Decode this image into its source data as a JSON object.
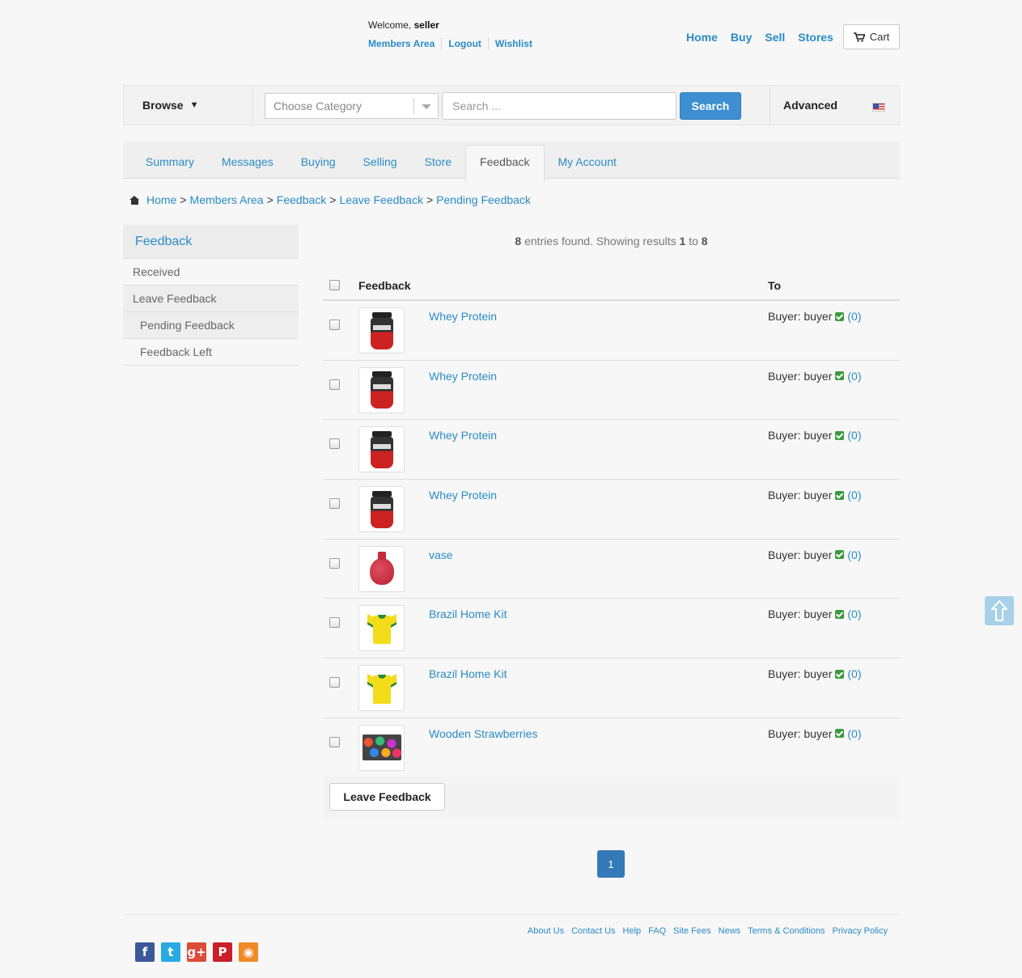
{
  "header": {
    "welcome_prefix": "Welcome,",
    "username": "seller",
    "member_links": [
      "Members Area",
      "Logout",
      "Wishlist"
    ],
    "nav": [
      "Home",
      "Buy",
      "Sell",
      "Stores"
    ],
    "cart_label": "Cart"
  },
  "search_bar": {
    "browse_label": "Browse",
    "category_placeholder": "Choose Category",
    "search_placeholder": "Search ...",
    "search_button": "Search",
    "advanced_label": "Advanced"
  },
  "tabs": [
    {
      "label": "Summary",
      "active": false
    },
    {
      "label": "Messages",
      "active": false
    },
    {
      "label": "Buying",
      "active": false
    },
    {
      "label": "Selling",
      "active": false
    },
    {
      "label": "Store",
      "active": false
    },
    {
      "label": "Feedback",
      "active": true
    },
    {
      "label": "My Account",
      "active": false
    }
  ],
  "breadcrumb": {
    "items": [
      "Home",
      "Members Area",
      "Feedback",
      "Leave Feedback",
      "Pending Feedback"
    ],
    "separator": ">"
  },
  "sidebar": {
    "heading": "Feedback",
    "items": [
      "Received",
      "Leave Feedback",
      "Pending Feedback",
      "Feedback Left"
    ]
  },
  "results": {
    "total": "8",
    "text_mid": "entries found. Showing results",
    "from": "1",
    "to_word": "to",
    "to": "8"
  },
  "table": {
    "col_feedback": "Feedback",
    "col_to": "To",
    "rows": [
      {
        "title": "Whey Protein",
        "to": "Buyer: buyer",
        "count": "(0)",
        "image": "whey"
      },
      {
        "title": "Whey Protein",
        "to": "Buyer: buyer",
        "count": "(0)",
        "image": "whey"
      },
      {
        "title": "Whey Protein",
        "to": "Buyer: buyer",
        "count": "(0)",
        "image": "whey"
      },
      {
        "title": "Whey Protein",
        "to": "Buyer: buyer",
        "count": "(0)",
        "image": "whey"
      },
      {
        "title": "vase",
        "to": "Buyer: buyer",
        "count": "(0)",
        "image": "vase"
      },
      {
        "title": "Brazil Home Kit",
        "to": "Buyer: buyer",
        "count": "(0)",
        "image": "shirt"
      },
      {
        "title": "Brazil Home Kit",
        "to": "Buyer: buyer",
        "count": "(0)",
        "image": "shirt"
      },
      {
        "title": "Wooden Strawberries",
        "to": "Buyer: buyer",
        "count": "(0)",
        "image": "strawberries"
      }
    ],
    "leave_feedback_button": "Leave Feedback"
  },
  "pagination": {
    "current": "1"
  },
  "footer": {
    "links": [
      "About Us",
      "Contact Us",
      "Help",
      "FAQ",
      "Site Fees",
      "News",
      "Terms & Conditions",
      "Privacy Policy"
    ],
    "social": [
      {
        "name": "facebook-icon",
        "glyph": "f",
        "color": "#3b5998"
      },
      {
        "name": "twitter-icon",
        "glyph": "t",
        "color": "#29a9e1"
      },
      {
        "name": "google-plus-icon",
        "glyph": "g+",
        "color": "#dd4b39"
      },
      {
        "name": "pinterest-icon",
        "glyph": "P",
        "color": "#cb2027"
      },
      {
        "name": "rss-icon",
        "glyph": "◉",
        "color": "#f08a24"
      }
    ]
  },
  "colors": {
    "link": "#2a8bc8",
    "primary_button": "#3d8fd1",
    "pagination_active": "#337ab7"
  }
}
